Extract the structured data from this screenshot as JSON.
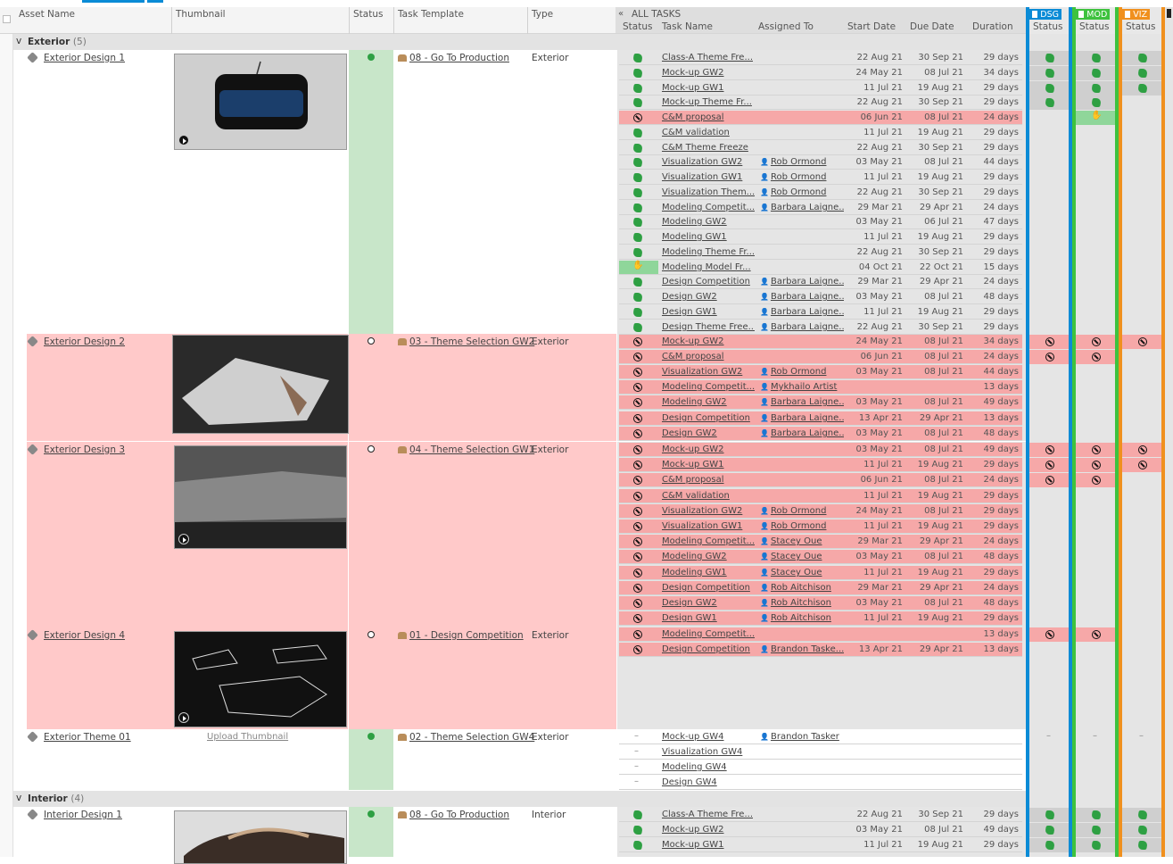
{
  "header": {
    "asset_name": "Asset Name",
    "thumbnail": "Thumbnail",
    "status": "Status",
    "task_template": "Task Template",
    "type": "Type",
    "all_tasks": "ALL TASKS",
    "task_status": "Status",
    "task_name": "Task Name",
    "assigned_to": "Assigned To",
    "start_date": "Start Date",
    "due_date": "Due Date",
    "duration": "Duration"
  },
  "departments": [
    {
      "label": "DSG",
      "sub": "Status",
      "color": "#0a8bd6"
    },
    {
      "label": "MOD",
      "sub": "Status",
      "color": "#3ec23e"
    },
    {
      "label": "VIZ",
      "sub": "Status",
      "color": "#f0901e"
    }
  ],
  "groups": [
    {
      "name": "Exterior",
      "count": "(5)"
    },
    {
      "name": "Interior",
      "count": "(4)"
    }
  ],
  "assets": [
    {
      "name": "Exterior Design 1",
      "template": "08 - Go To Production",
      "type": "Exterior",
      "status": "ok"
    },
    {
      "name": "Exterior Design 2",
      "template": "03 - Theme Selection GW2",
      "type": "Exterior",
      "status": "no"
    },
    {
      "name": "Exterior Design 3",
      "template": "04 - Theme Selection GW1",
      "type": "Exterior",
      "status": "no"
    },
    {
      "name": "Exterior Design 4",
      "template": "01 - Design Competition",
      "type": "Exterior",
      "status": "no"
    },
    {
      "name": "Exterior Theme 01",
      "template": "02 - Theme Selection GW4",
      "type": "Exterior",
      "status": "ok",
      "upload": "Upload Thumbnail"
    },
    {
      "name": "Interior Design 1",
      "template": "08 - Go To Production",
      "type": "Interior",
      "status": "ok"
    }
  ],
  "tasks": [
    {
      "st": "ok",
      "name": "Class-A Theme Fre...",
      "who": "",
      "sd": "22 Aug 21",
      "dd": "30 Sep 21",
      "du": "29 days",
      "d": [
        "ok",
        "ok",
        "ok"
      ]
    },
    {
      "st": "ok",
      "name": "Mock-up GW2",
      "who": "",
      "sd": "24 May 21",
      "dd": "08 Jul 21",
      "du": "34 days",
      "d": [
        "ok",
        "ok",
        "ok"
      ]
    },
    {
      "st": "ok",
      "name": "Mock-up GW1",
      "who": "",
      "sd": "11 Jul 21",
      "dd": "19 Aug 21",
      "du": "29 days",
      "d": [
        "ok",
        "ok",
        "ok"
      ]
    },
    {
      "st": "ok",
      "name": "Mock-up Theme Fr...",
      "who": "",
      "sd": "22 Aug 21",
      "dd": "30 Sep 21",
      "du": "29 days",
      "d": [
        "ok",
        "ok",
        ""
      ]
    },
    {
      "st": "no",
      "name": "C&M proposal",
      "who": "",
      "sd": "06 Jun 21",
      "dd": "08 Jul 21",
      "du": "24 days",
      "red": true,
      "d": [
        "",
        "hand",
        ""
      ]
    },
    {
      "st": "ok",
      "name": "C&M validation",
      "who": "",
      "sd": "11 Jul 21",
      "dd": "19 Aug 21",
      "du": "29 days",
      "d": [
        "",
        "",
        ""
      ]
    },
    {
      "st": "ok",
      "name": "C&M Theme Freeze",
      "who": "",
      "sd": "22 Aug 21",
      "dd": "30 Sep 21",
      "du": "29 days",
      "d": [
        "",
        "",
        ""
      ]
    },
    {
      "st": "ok",
      "name": "Visualization GW2",
      "who": "Rob Ormond",
      "sd": "03 May 21",
      "dd": "08 Jul 21",
      "du": "44 days",
      "d": [
        "",
        "",
        ""
      ]
    },
    {
      "st": "ok",
      "name": "Visualization GW1",
      "who": "Rob Ormond",
      "sd": "11 Jul 21",
      "dd": "19 Aug 21",
      "du": "29 days",
      "d": [
        "",
        "",
        ""
      ]
    },
    {
      "st": "ok",
      "name": "Visualization Them...",
      "who": "Rob Ormond",
      "sd": "22 Aug 21",
      "dd": "30 Sep 21",
      "du": "29 days",
      "d": [
        "",
        "",
        ""
      ]
    },
    {
      "st": "ok",
      "name": "Modeling Competit...",
      "who": "Barbara Laigne...",
      "sd": "29 Mar 21",
      "dd": "29 Apr 21",
      "du": "24 days",
      "d": [
        "",
        "",
        ""
      ]
    },
    {
      "st": "ok",
      "name": "Modeling GW2",
      "who": "",
      "sd": "03 May 21",
      "dd": "06 Jul 21",
      "du": "47 days",
      "d": [
        "",
        "",
        ""
      ]
    },
    {
      "st": "ok",
      "name": "Modeling GW1",
      "who": "",
      "sd": "11 Jul 21",
      "dd": "19 Aug 21",
      "du": "29 days",
      "d": [
        "",
        "",
        ""
      ]
    },
    {
      "st": "ok",
      "name": "Modeling Theme Fr...",
      "who": "",
      "sd": "22 Aug 21",
      "dd": "30 Sep 21",
      "du": "29 days",
      "d": [
        "",
        "",
        ""
      ]
    },
    {
      "st": "hand",
      "name": "Modeling Model Fr...",
      "who": "",
      "sd": "04 Oct 21",
      "dd": "22 Oct 21",
      "du": "15 days",
      "d": [
        "",
        "",
        ""
      ]
    },
    {
      "st": "ok",
      "name": "Design Competition",
      "who": "Barbara Laigne...",
      "sd": "29 Mar 21",
      "dd": "29 Apr 21",
      "du": "24 days",
      "d": [
        "",
        "",
        ""
      ]
    },
    {
      "st": "ok",
      "name": "Design GW2",
      "who": "Barbara Laigne...",
      "sd": "03 May 21",
      "dd": "08 Jul 21",
      "du": "48 days",
      "d": [
        "",
        "",
        ""
      ]
    },
    {
      "st": "ok",
      "name": "Design GW1",
      "who": "Barbara Laigne...",
      "sd": "11 Jul 21",
      "dd": "19 Aug 21",
      "du": "29 days",
      "d": [
        "",
        "",
        ""
      ]
    },
    {
      "st": "ok",
      "name": "Design Theme Free...",
      "who": "Barbara Laigne...",
      "sd": "22 Aug 21",
      "dd": "30 Sep 21",
      "du": "29 days",
      "d": [
        "",
        "",
        ""
      ]
    },
    {
      "st": "no",
      "name": "Mock-up GW2",
      "who": "",
      "sd": "24 May 21",
      "dd": "08 Jul 21",
      "du": "34 days",
      "red": true,
      "d": [
        "no",
        "no",
        "no"
      ]
    },
    {
      "st": "no",
      "name": "C&M proposal",
      "who": "",
      "sd": "06 Jun 21",
      "dd": "08 Jul 21",
      "du": "24 days",
      "red": true,
      "d": [
        "no",
        "no",
        ""
      ]
    },
    {
      "st": "no",
      "name": "Visualization GW2",
      "who": "Rob Ormond",
      "sd": "03 May 21",
      "dd": "08 Jul 21",
      "du": "44 days",
      "red": true,
      "d": [
        "",
        "",
        ""
      ]
    },
    {
      "st": "no",
      "name": "Modeling Competit...",
      "who": "Mykhailo Artist",
      "sd": "",
      "dd": "",
      "du": "13 days",
      "red": true,
      "d": [
        "",
        "",
        ""
      ]
    },
    {
      "st": "no",
      "name": "Modeling GW2",
      "who": "Barbara Laigne...",
      "sd": "03 May 21",
      "dd": "08 Jul 21",
      "du": "49 days",
      "red": true,
      "d": [
        "",
        "",
        ""
      ]
    },
    {
      "st": "no",
      "name": "Design Competition",
      "who": "Barbara Laigne...",
      "sd": "13 Apr 21",
      "dd": "29 Apr 21",
      "du": "13 days",
      "red": true,
      "d": [
        "",
        "",
        ""
      ]
    },
    {
      "st": "no",
      "name": "Design GW2",
      "who": "Barbara Laigne...",
      "sd": "03 May 21",
      "dd": "08 Jul 21",
      "du": "48 days",
      "red": true,
      "d": [
        "",
        "",
        ""
      ]
    },
    {
      "st": "no",
      "name": "Mock-up GW2",
      "who": "",
      "sd": "03 May 21",
      "dd": "08 Jul 21",
      "du": "49 days",
      "red": true,
      "d": [
        "no",
        "no",
        "no"
      ]
    },
    {
      "st": "no",
      "name": "Mock-up GW1",
      "who": "",
      "sd": "11 Jul 21",
      "dd": "19 Aug 21",
      "du": "29 days",
      "red": true,
      "d": [
        "no",
        "no",
        "no"
      ]
    },
    {
      "st": "no",
      "name": "C&M proposal",
      "who": "",
      "sd": "06 Jun 21",
      "dd": "08 Jul 21",
      "du": "24 days",
      "red": true,
      "d": [
        "no",
        "no",
        ""
      ]
    },
    {
      "st": "no",
      "name": "C&M validation",
      "who": "",
      "sd": "11 Jul 21",
      "dd": "19 Aug 21",
      "du": "29 days",
      "red": true,
      "d": [
        "",
        "",
        ""
      ]
    },
    {
      "st": "no",
      "name": "Visualization GW2",
      "who": "Rob Ormond",
      "sd": "24 May 21",
      "dd": "08 Jul 21",
      "du": "29 days",
      "red": true,
      "d": [
        "",
        "",
        ""
      ]
    },
    {
      "st": "no",
      "name": "Visualization GW1",
      "who": "Rob Ormond",
      "sd": "11 Jul 21",
      "dd": "19 Aug 21",
      "du": "29 days",
      "red": true,
      "d": [
        "",
        "",
        ""
      ]
    },
    {
      "st": "no",
      "name": "Modeling Competit...",
      "who": "Stacey Oue",
      "sd": "29 Mar 21",
      "dd": "29 Apr 21",
      "du": "24 days",
      "red": true,
      "d": [
        "",
        "",
        ""
      ]
    },
    {
      "st": "no",
      "name": "Modeling GW2",
      "who": "Stacey Oue",
      "sd": "03 May 21",
      "dd": "08 Jul 21",
      "du": "48 days",
      "red": true,
      "d": [
        "",
        "",
        ""
      ]
    },
    {
      "st": "no",
      "name": "Modeling GW1",
      "who": "Stacey Oue",
      "sd": "11 Jul 21",
      "dd": "19 Aug 21",
      "du": "29 days",
      "red": true,
      "d": [
        "",
        "",
        ""
      ]
    },
    {
      "st": "no",
      "name": "Design Competition",
      "who": "Rob Aitchison",
      "sd": "29 Mar 21",
      "dd": "29 Apr 21",
      "du": "24 days",
      "red": true,
      "d": [
        "",
        "",
        ""
      ]
    },
    {
      "st": "no",
      "name": "Design GW2",
      "who": "Rob Aitchison",
      "sd": "03 May 21",
      "dd": "08 Jul 21",
      "du": "48 days",
      "red": true,
      "d": [
        "",
        "",
        ""
      ]
    },
    {
      "st": "no",
      "name": "Design GW1",
      "who": "Rob Aitchison",
      "sd": "11 Jul 21",
      "dd": "19 Aug 21",
      "du": "29 days",
      "red": true,
      "d": [
        "",
        "",
        ""
      ]
    },
    {
      "st": "no",
      "name": "Modeling Competit...",
      "who": "",
      "sd": "",
      "dd": "",
      "du": "13 days",
      "red": true,
      "d": [
        "no",
        "no",
        ""
      ]
    },
    {
      "st": "no",
      "name": "Design Competition",
      "who": "Brandon Taske...",
      "sd": "13 Apr 21",
      "dd": "29 Apr 21",
      "du": "13 days",
      "red": true,
      "d": [
        "",
        "",
        ""
      ]
    },
    {
      "st": "dash",
      "name": "Mock-up GW4",
      "who": "Brandon Tasker",
      "sd": "",
      "dd": "",
      "du": "",
      "white": true,
      "d": [
        "dash",
        "dash",
        "dash"
      ]
    },
    {
      "st": "dash",
      "name": "Visualization GW4",
      "who": "",
      "sd": "",
      "dd": "",
      "du": "",
      "white": true,
      "d": [
        "",
        "",
        ""
      ]
    },
    {
      "st": "dash",
      "name": "Modeling GW4",
      "who": "",
      "sd": "",
      "dd": "",
      "du": "",
      "white": true,
      "d": [
        "",
        "",
        ""
      ]
    },
    {
      "st": "dash",
      "name": "Design GW4",
      "who": "",
      "sd": "",
      "dd": "",
      "du": "",
      "white": true,
      "d": [
        "",
        "",
        ""
      ]
    },
    {
      "st": "ok",
      "name": "Class-A Theme Fre...",
      "who": "",
      "sd": "22 Aug 21",
      "dd": "30 Sep 21",
      "du": "29 days",
      "d": [
        "ok",
        "ok",
        "ok"
      ]
    },
    {
      "st": "ok",
      "name": "Mock-up GW2",
      "who": "",
      "sd": "03 May 21",
      "dd": "08 Jul 21",
      "du": "49 days",
      "d": [
        "ok",
        "ok",
        "ok"
      ]
    },
    {
      "st": "ok",
      "name": "Mock-up GW1",
      "who": "",
      "sd": "11 Jul 21",
      "dd": "19 Aug 21",
      "du": "29 days",
      "d": [
        "ok",
        "ok",
        "ok"
      ]
    }
  ]
}
